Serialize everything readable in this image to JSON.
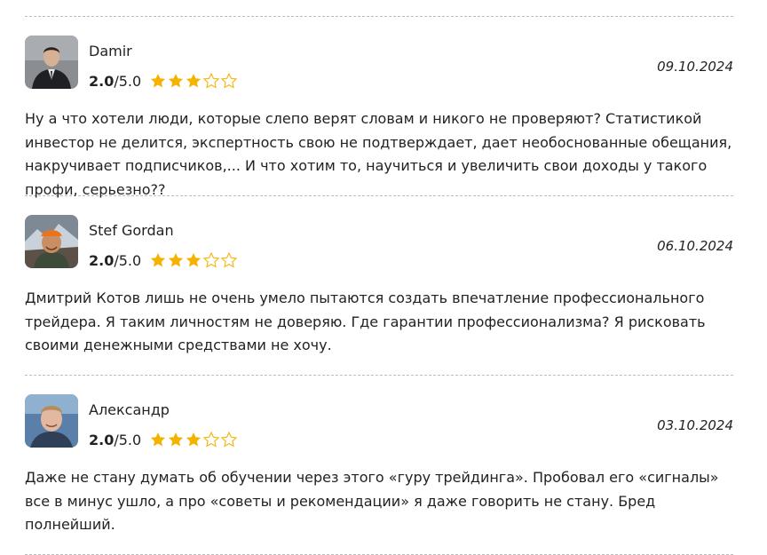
{
  "reviews": [
    {
      "author": "Damir",
      "score": "2.0",
      "outof": "/5.0",
      "stars_filled": 3,
      "stars_total": 5,
      "date": "09.10.2024",
      "text": "Ну а что хотели люди, которые слепо верят словам и никого не проверяют? Статистикой инвестор не делится, экспертность свою не подтверждает, дает необоснованные обещания, накручивает подписчиков,... И что хотим то, научиться и увеличить свои доходы у такого профи, серьезно??"
    },
    {
      "author": "Stef Gordan",
      "score": "2.0",
      "outof": "/5.0",
      "stars_filled": 3,
      "stars_total": 5,
      "date": "06.10.2024",
      "text": "Дмитрий Котов лишь не очень умело пытаются создать впечатление профессионального трейдера. Я таким личностям не доверяю. Где гарантии профессионализма? Я рисковать своими денежными средствами не хочу."
    },
    {
      "author": "Александр",
      "score": "2.0",
      "outof": "/5.0",
      "stars_filled": 3,
      "stars_total": 5,
      "date": "03.10.2024",
      "text": "Даже не стану думать об обучении через этого «гуру трейдинга». Пробовал его «сигналы» все в минус ушло, а про «советы и рекомендации» я даже говорить не стану. Бред полнейший."
    }
  ],
  "colors": {
    "star_filled": "#f5b301",
    "star_empty_outline": "#f5b301",
    "divider": "#bdbdbd"
  },
  "icons": {
    "star_filled": "star-filled-icon",
    "star_empty": "star-outline-icon"
  }
}
